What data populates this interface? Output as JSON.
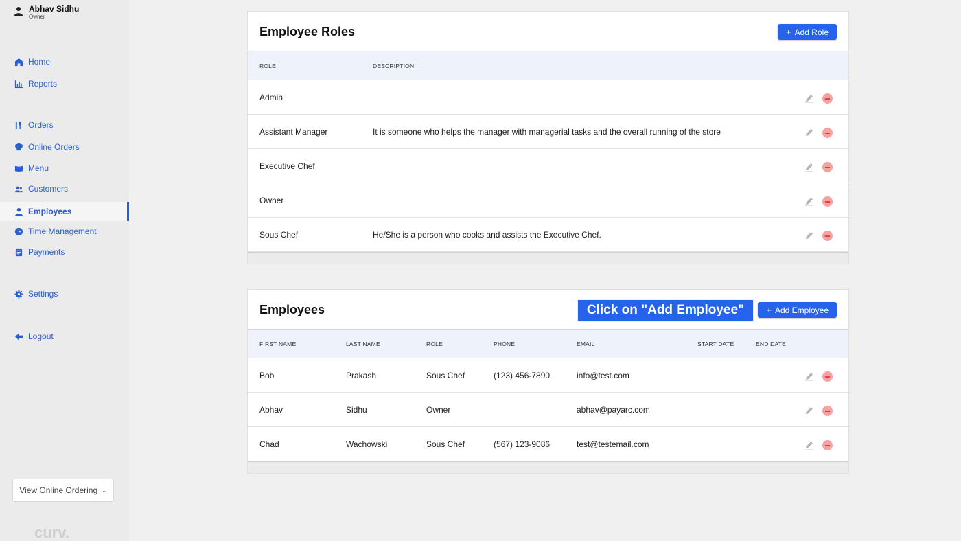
{
  "user": {
    "name": "Abhav Sidhu",
    "role": "Owner"
  },
  "nav": [
    {
      "label": "Home",
      "icon": "home-icon"
    },
    {
      "label": "Reports",
      "icon": "chart-icon"
    },
    {
      "label": "Orders",
      "icon": "utensils-icon"
    },
    {
      "label": "Online Orders",
      "icon": "chef-hat-icon"
    },
    {
      "label": "Menu",
      "icon": "book-icon"
    },
    {
      "label": "Customers",
      "icon": "customers-icon"
    },
    {
      "label": "Employees",
      "icon": "user-icon"
    },
    {
      "label": "Time Management",
      "icon": "clock-icon"
    },
    {
      "label": "Payments",
      "icon": "document-icon"
    },
    {
      "label": "Settings",
      "icon": "gear-icon"
    },
    {
      "label": "Logout",
      "icon": "arrow-left-icon"
    }
  ],
  "view_online_ordering": "View Online Ordering",
  "brand": "curv.",
  "roles_card": {
    "title": "Employee Roles",
    "add_button": "Add Role",
    "columns": [
      "ROLE",
      "DESCRIPTION"
    ],
    "rows": [
      {
        "role": "Admin",
        "description": ""
      },
      {
        "role": "Assistant Manager",
        "description": "It is someone who helps the manager with managerial tasks and the overall running of the store"
      },
      {
        "role": "Executive Chef",
        "description": ""
      },
      {
        "role": "Owner",
        "description": ""
      },
      {
        "role": "Sous Chef",
        "description": "He/She is a person who cooks and assists the Executive Chef."
      }
    ]
  },
  "employees_card": {
    "title": "Employees",
    "add_button": "Add Employee",
    "tooltip": "Click on \"Add Employee\"",
    "columns": [
      "FIRST NAME",
      "LAST NAME",
      "ROLE",
      "PHONE",
      "EMAIL",
      "START DATE",
      "END DATE"
    ],
    "rows": [
      {
        "first": "Bob",
        "last": "Prakash",
        "role": "Sous Chef",
        "phone": "(123) 456-7890",
        "email": "info@test.com",
        "start": "",
        "end": ""
      },
      {
        "first": "Abhav",
        "last": "Sidhu",
        "role": "Owner",
        "phone": "",
        "email": "abhav@payarc.com",
        "start": "",
        "end": ""
      },
      {
        "first": "Chad",
        "last": "Wachowski",
        "role": "Sous Chef",
        "phone": "(567) 123-9086",
        "email": "test@testemail.com",
        "start": "",
        "end": ""
      }
    ]
  },
  "colors": {
    "accent": "#2563eb",
    "nav_text": "#2a5fd0",
    "delete": "#e04040"
  }
}
